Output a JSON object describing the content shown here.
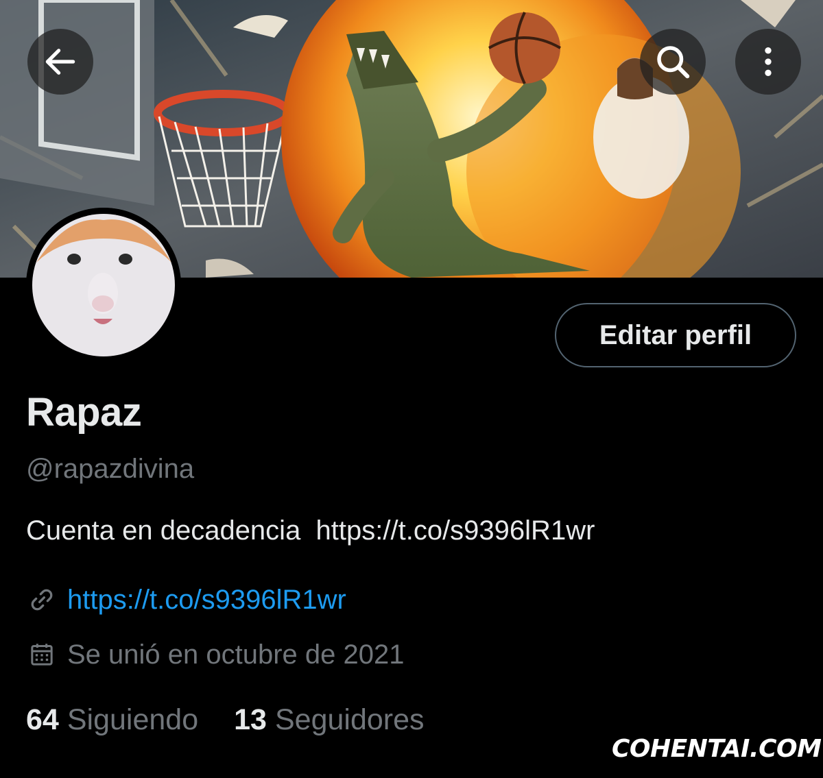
{
  "header": {
    "back_icon": "arrow-left-icon",
    "search_icon": "search-icon",
    "more_icon": "more-vertical-icon"
  },
  "profile": {
    "edit_button_label": "Editar perfil",
    "display_name": "Rapaz",
    "handle": "@rapazdivina",
    "bio": "Cuenta en decadencia  https://t.co/s9396lR1wr",
    "link_icon": "link-icon",
    "link": "https://t.co/s9396lR1wr",
    "joined_icon": "calendar-icon",
    "joined": "Se unió en octubre de 2021"
  },
  "stats": {
    "following_count": "64",
    "following_label": "Siguiendo",
    "followers_count": "13",
    "followers_label": "Seguidores"
  },
  "watermark": "COHENTAI.COM",
  "colors": {
    "background": "#000000",
    "primary_text": "#e7e9ea",
    "secondary_text": "#71767b",
    "link": "#1d9bf0",
    "button_border": "#536471"
  }
}
